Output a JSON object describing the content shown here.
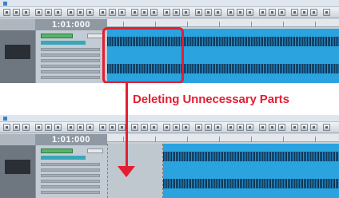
{
  "top_panel": {
    "counter": "1:01:000"
  },
  "bottom_panel": {
    "counter": "1:01:000"
  },
  "caption": "Deleting Unnecessary Parts",
  "colors": {
    "accent": "#e31e32",
    "waveform": "#2aa3df",
    "waveform_dark": "#0d3554"
  },
  "icons": {
    "arrow": "arrow-down-icon"
  }
}
